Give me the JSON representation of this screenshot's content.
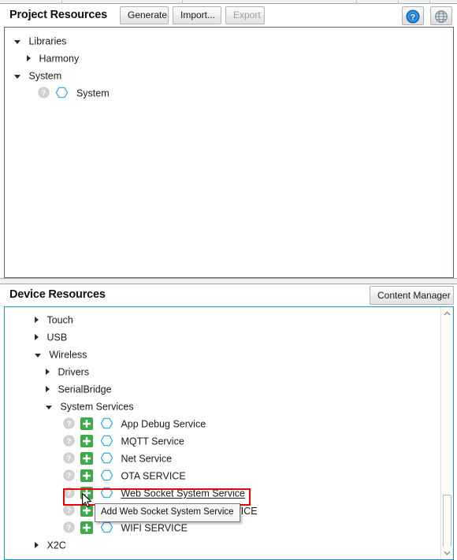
{
  "window": {
    "project_panel": {
      "title": "Project Resources",
      "buttons": [
        {
          "label": "Generate",
          "disabled": false
        },
        {
          "label": "Import...",
          "disabled": false
        },
        {
          "label": "Export",
          "disabled": true
        }
      ],
      "help_icon": "help-icon",
      "globe_icon": "globe-icon",
      "tree": [
        {
          "label": "Libraries",
          "state": "expanded",
          "depth": 0,
          "icons": []
        },
        {
          "label": "Harmony",
          "state": "collapsed",
          "depth": 1,
          "icons": []
        },
        {
          "label": "System",
          "state": "expanded",
          "depth": 0,
          "icons": []
        },
        {
          "label": "System",
          "state": "leaf",
          "depth": 2,
          "icons": [
            "help-icon",
            "hexagon-icon"
          ]
        }
      ]
    },
    "device_panel": {
      "title": "Device Resources",
      "content_manager_label": "Content Manager",
      "tree": [
        {
          "label": "Touch",
          "state": "collapsed",
          "depth": 1,
          "icons": []
        },
        {
          "label": "USB",
          "state": "collapsed",
          "depth": 1,
          "icons": []
        },
        {
          "label": "Wireless",
          "state": "expanded",
          "depth": 1,
          "icons": []
        },
        {
          "label": "Drivers",
          "state": "collapsed",
          "depth": 2,
          "icons": []
        },
        {
          "label": "SerialBridge",
          "state": "collapsed",
          "depth": 2,
          "icons": []
        },
        {
          "label": "System Services",
          "state": "expanded",
          "depth": 2,
          "icons": []
        },
        {
          "label": "App Debug Service",
          "state": "leaf",
          "depth": 4,
          "icons": [
            "help-icon",
            "add-icon",
            "hexagon-icon"
          ]
        },
        {
          "label": "MQTT Service",
          "state": "leaf",
          "depth": 4,
          "icons": [
            "help-icon",
            "add-icon",
            "hexagon-icon"
          ]
        },
        {
          "label": "Net Service",
          "state": "leaf",
          "depth": 4,
          "icons": [
            "help-icon",
            "add-icon",
            "hexagon-icon"
          ]
        },
        {
          "label": "OTA SERVICE",
          "state": "leaf",
          "depth": 4,
          "icons": [
            "help-icon",
            "add-icon",
            "hexagon-icon"
          ]
        },
        {
          "label": "Web Socket System Service",
          "state": "leaf",
          "depth": 4,
          "hovered": true,
          "icons": [
            "help-icon",
            "add-icon",
            "hexagon-icon"
          ]
        },
        {
          "label": "VICE",
          "state": "leaf",
          "depth": 4,
          "occluded": true,
          "icons": [
            "help-icon",
            "add-icon",
            "hexagon-icon"
          ]
        },
        {
          "label": "WIFI SERVICE",
          "state": "leaf",
          "depth": 4,
          "icons": [
            "help-icon",
            "add-icon",
            "hexagon-icon"
          ]
        },
        {
          "label": "X2C",
          "state": "collapsed",
          "depth": 1,
          "icons": []
        }
      ]
    },
    "tooltip": {
      "text": "Add Web Socket System Service"
    },
    "colors": {
      "accent_blue": "#2196c4",
      "add_green": "#3dab47",
      "hexagon_blue": "#29a4e0",
      "annotation_red": "#ee0000",
      "help_gray": "#c9c9c9",
      "panel_border": "#5d6773"
    }
  }
}
